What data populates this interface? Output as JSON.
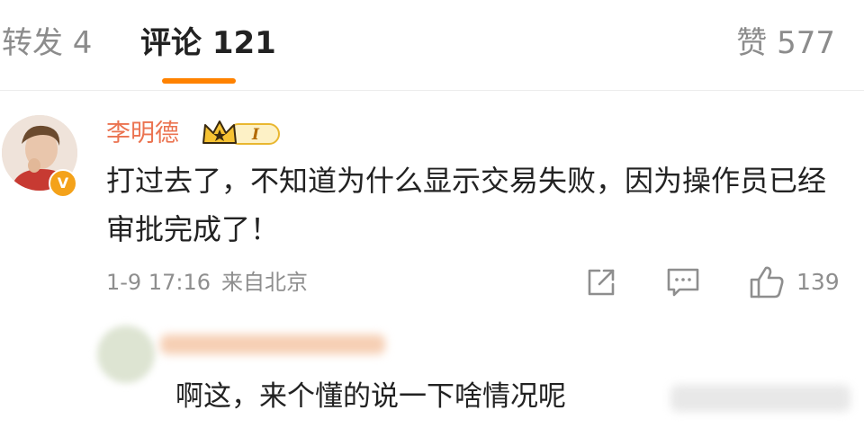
{
  "tabs": {
    "repost": "转发 4",
    "comments": "评论 121",
    "likes": "赞 577"
  },
  "comment": {
    "username": "李明德",
    "badge_level": "I",
    "verified_mark": "V",
    "text": "打过去了，不知道为什么显示交易失败，因为操作员已经审批完成了！",
    "date": "1-9 17:16",
    "location": "来自北京",
    "like_count": "139"
  },
  "reply": {
    "text": "啊这，来个懂的说一下啥情况呢"
  },
  "colors": {
    "accent_orange": "#ff8200",
    "username": "#eb7350",
    "muted_text": "#8e8e8e"
  },
  "icons": [
    "share-icon",
    "reply-icon",
    "like-icon",
    "crown-icon",
    "verified-icon"
  ]
}
